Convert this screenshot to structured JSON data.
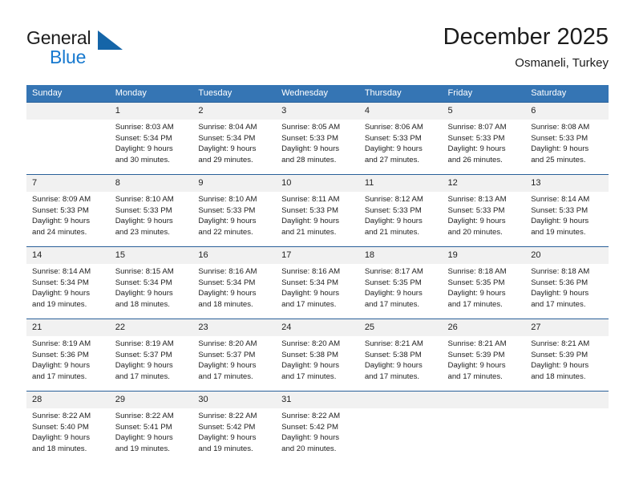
{
  "logo": {
    "word_top": "General",
    "word_bottom": "Blue",
    "triangle_color": "#1565a8",
    "blue_color": "#1779cf"
  },
  "header": {
    "title": "December 2025",
    "subtitle": "Osmaneli, Turkey"
  },
  "theme": {
    "header_bg": "#3575b4",
    "row_divider": "#2a6099",
    "daynum_bg": "#f1f1f1"
  },
  "calendar": {
    "weekday_headers": [
      "Sunday",
      "Monday",
      "Tuesday",
      "Wednesday",
      "Thursday",
      "Friday",
      "Saturday"
    ],
    "weeks": [
      [
        {
          "day": "",
          "lines": []
        },
        {
          "day": "1",
          "lines": [
            "Sunrise: 8:03 AM",
            "Sunset: 5:34 PM",
            "Daylight: 9 hours",
            "and 30 minutes."
          ]
        },
        {
          "day": "2",
          "lines": [
            "Sunrise: 8:04 AM",
            "Sunset: 5:34 PM",
            "Daylight: 9 hours",
            "and 29 minutes."
          ]
        },
        {
          "day": "3",
          "lines": [
            "Sunrise: 8:05 AM",
            "Sunset: 5:33 PM",
            "Daylight: 9 hours",
            "and 28 minutes."
          ]
        },
        {
          "day": "4",
          "lines": [
            "Sunrise: 8:06 AM",
            "Sunset: 5:33 PM",
            "Daylight: 9 hours",
            "and 27 minutes."
          ]
        },
        {
          "day": "5",
          "lines": [
            "Sunrise: 8:07 AM",
            "Sunset: 5:33 PM",
            "Daylight: 9 hours",
            "and 26 minutes."
          ]
        },
        {
          "day": "6",
          "lines": [
            "Sunrise: 8:08 AM",
            "Sunset: 5:33 PM",
            "Daylight: 9 hours",
            "and 25 minutes."
          ]
        }
      ],
      [
        {
          "day": "7",
          "lines": [
            "Sunrise: 8:09 AM",
            "Sunset: 5:33 PM",
            "Daylight: 9 hours",
            "and 24 minutes."
          ]
        },
        {
          "day": "8",
          "lines": [
            "Sunrise: 8:10 AM",
            "Sunset: 5:33 PM",
            "Daylight: 9 hours",
            "and 23 minutes."
          ]
        },
        {
          "day": "9",
          "lines": [
            "Sunrise: 8:10 AM",
            "Sunset: 5:33 PM",
            "Daylight: 9 hours",
            "and 22 minutes."
          ]
        },
        {
          "day": "10",
          "lines": [
            "Sunrise: 8:11 AM",
            "Sunset: 5:33 PM",
            "Daylight: 9 hours",
            "and 21 minutes."
          ]
        },
        {
          "day": "11",
          "lines": [
            "Sunrise: 8:12 AM",
            "Sunset: 5:33 PM",
            "Daylight: 9 hours",
            "and 21 minutes."
          ]
        },
        {
          "day": "12",
          "lines": [
            "Sunrise: 8:13 AM",
            "Sunset: 5:33 PM",
            "Daylight: 9 hours",
            "and 20 minutes."
          ]
        },
        {
          "day": "13",
          "lines": [
            "Sunrise: 8:14 AM",
            "Sunset: 5:33 PM",
            "Daylight: 9 hours",
            "and 19 minutes."
          ]
        }
      ],
      [
        {
          "day": "14",
          "lines": [
            "Sunrise: 8:14 AM",
            "Sunset: 5:34 PM",
            "Daylight: 9 hours",
            "and 19 minutes."
          ]
        },
        {
          "day": "15",
          "lines": [
            "Sunrise: 8:15 AM",
            "Sunset: 5:34 PM",
            "Daylight: 9 hours",
            "and 18 minutes."
          ]
        },
        {
          "day": "16",
          "lines": [
            "Sunrise: 8:16 AM",
            "Sunset: 5:34 PM",
            "Daylight: 9 hours",
            "and 18 minutes."
          ]
        },
        {
          "day": "17",
          "lines": [
            "Sunrise: 8:16 AM",
            "Sunset: 5:34 PM",
            "Daylight: 9 hours",
            "and 17 minutes."
          ]
        },
        {
          "day": "18",
          "lines": [
            "Sunrise: 8:17 AM",
            "Sunset: 5:35 PM",
            "Daylight: 9 hours",
            "and 17 minutes."
          ]
        },
        {
          "day": "19",
          "lines": [
            "Sunrise: 8:18 AM",
            "Sunset: 5:35 PM",
            "Daylight: 9 hours",
            "and 17 minutes."
          ]
        },
        {
          "day": "20",
          "lines": [
            "Sunrise: 8:18 AM",
            "Sunset: 5:36 PM",
            "Daylight: 9 hours",
            "and 17 minutes."
          ]
        }
      ],
      [
        {
          "day": "21",
          "lines": [
            "Sunrise: 8:19 AM",
            "Sunset: 5:36 PM",
            "Daylight: 9 hours",
            "and 17 minutes."
          ]
        },
        {
          "day": "22",
          "lines": [
            "Sunrise: 8:19 AM",
            "Sunset: 5:37 PM",
            "Daylight: 9 hours",
            "and 17 minutes."
          ]
        },
        {
          "day": "23",
          "lines": [
            "Sunrise: 8:20 AM",
            "Sunset: 5:37 PM",
            "Daylight: 9 hours",
            "and 17 minutes."
          ]
        },
        {
          "day": "24",
          "lines": [
            "Sunrise: 8:20 AM",
            "Sunset: 5:38 PM",
            "Daylight: 9 hours",
            "and 17 minutes."
          ]
        },
        {
          "day": "25",
          "lines": [
            "Sunrise: 8:21 AM",
            "Sunset: 5:38 PM",
            "Daylight: 9 hours",
            "and 17 minutes."
          ]
        },
        {
          "day": "26",
          "lines": [
            "Sunrise: 8:21 AM",
            "Sunset: 5:39 PM",
            "Daylight: 9 hours",
            "and 17 minutes."
          ]
        },
        {
          "day": "27",
          "lines": [
            "Sunrise: 8:21 AM",
            "Sunset: 5:39 PM",
            "Daylight: 9 hours",
            "and 18 minutes."
          ]
        }
      ],
      [
        {
          "day": "28",
          "lines": [
            "Sunrise: 8:22 AM",
            "Sunset: 5:40 PM",
            "Daylight: 9 hours",
            "and 18 minutes."
          ]
        },
        {
          "day": "29",
          "lines": [
            "Sunrise: 8:22 AM",
            "Sunset: 5:41 PM",
            "Daylight: 9 hours",
            "and 19 minutes."
          ]
        },
        {
          "day": "30",
          "lines": [
            "Sunrise: 8:22 AM",
            "Sunset: 5:42 PM",
            "Daylight: 9 hours",
            "and 19 minutes."
          ]
        },
        {
          "day": "31",
          "lines": [
            "Sunrise: 8:22 AM",
            "Sunset: 5:42 PM",
            "Daylight: 9 hours",
            "and 20 minutes."
          ]
        },
        {
          "day": "",
          "lines": []
        },
        {
          "day": "",
          "lines": []
        },
        {
          "day": "",
          "lines": []
        }
      ]
    ]
  }
}
